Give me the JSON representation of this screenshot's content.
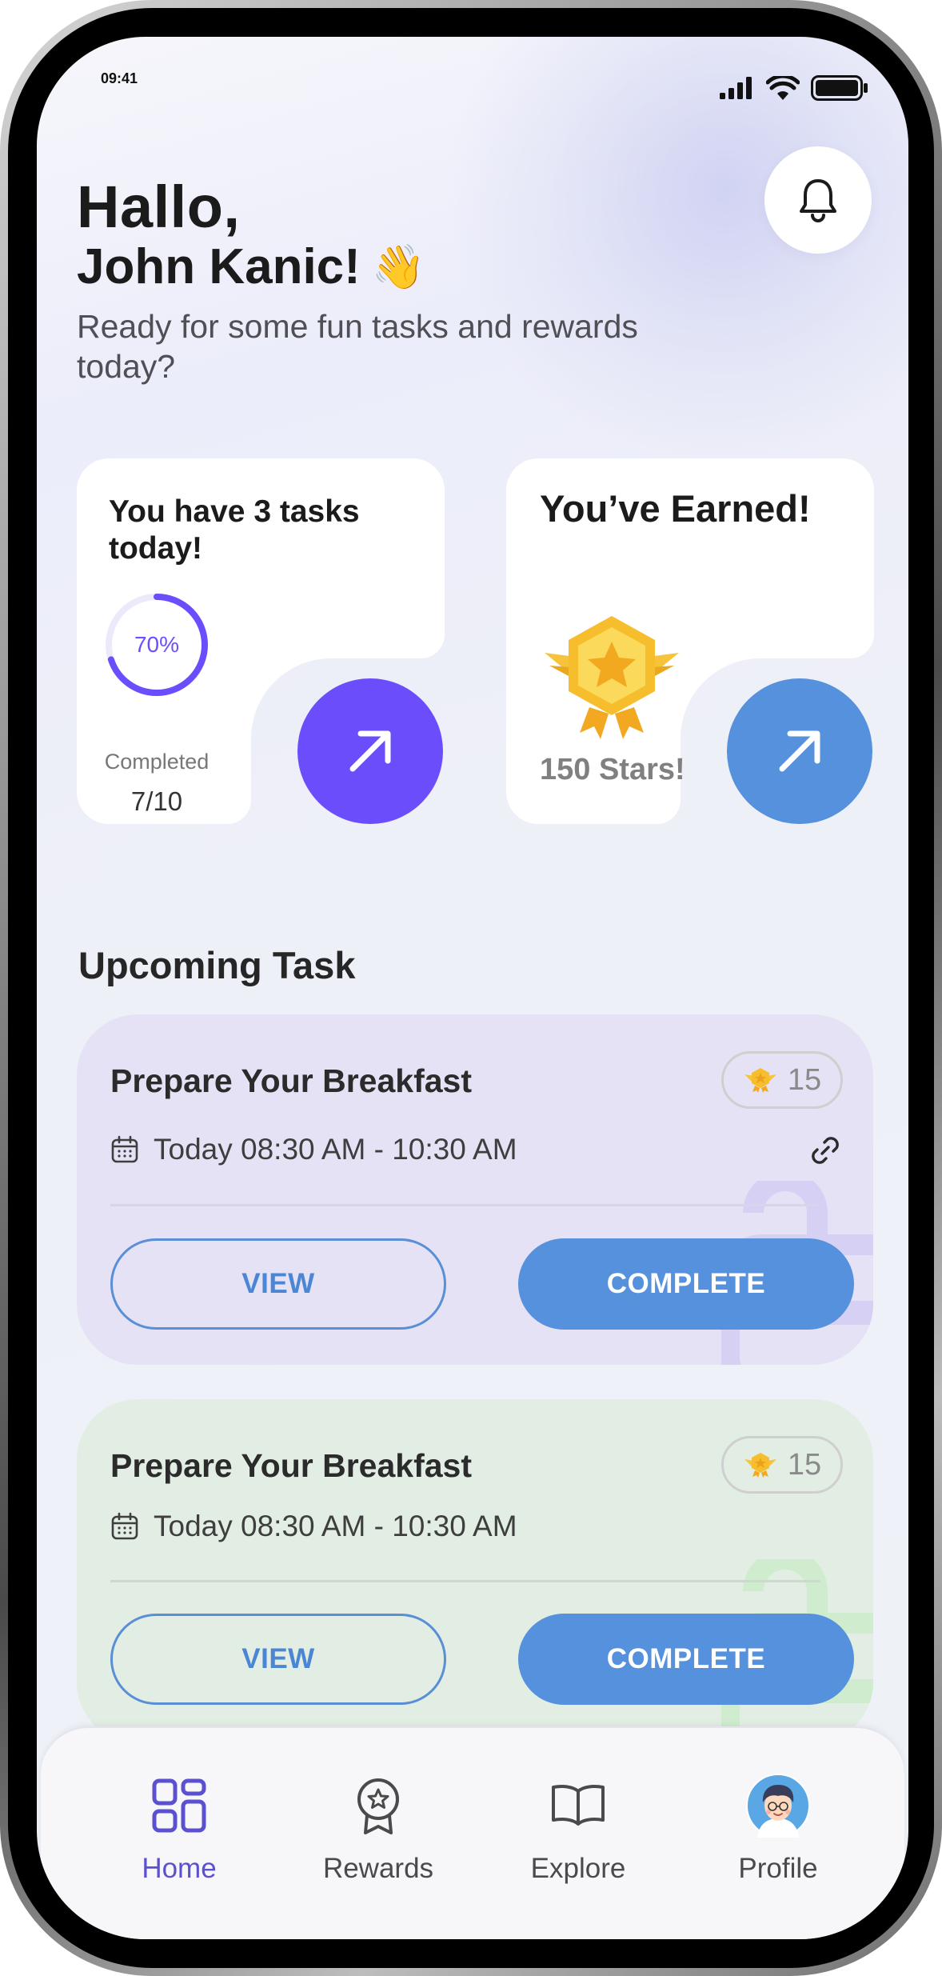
{
  "status_bar": {
    "time": "09:41"
  },
  "header": {
    "greeting": "Hallo,",
    "name": "John Kanic!",
    "wave_emoji": "👋",
    "subtitle": "Ready for some fun tasks and rewards today?"
  },
  "tasks_card": {
    "title": "You have 3 tasks today!",
    "progress_percent": 70,
    "progress_label": "70%",
    "completed_label": "Completed",
    "completed_value": "7/10"
  },
  "earned_card": {
    "title": "You’ve Earned!",
    "stars_text": "150 Stars!"
  },
  "upcoming": {
    "section_title": "Upcoming Task",
    "tasks": [
      {
        "name": "Prepare Your Breakfast",
        "points": "15",
        "time": "Today 08:30 AM - 10:30 AM",
        "view_label": "VIEW",
        "complete_label": "COMPLETE"
      },
      {
        "name": "Prepare Your Breakfast",
        "points": "15",
        "time": "Today 08:30 AM - 10:30 AM",
        "view_label": "VIEW",
        "complete_label": "COMPLETE"
      }
    ]
  },
  "bottom_nav": {
    "items": [
      {
        "label": "Home",
        "icon": "grid-icon",
        "active": true
      },
      {
        "label": "Rewards",
        "icon": "award-icon",
        "active": false
      },
      {
        "label": "Explore",
        "icon": "book-icon",
        "active": false
      },
      {
        "label": "Profile",
        "icon": "avatar",
        "active": false
      }
    ]
  },
  "colors": {
    "accent_purple": "#6b4dfc",
    "accent_blue": "#5591dc",
    "task_purple_bg": "#e6e2f6",
    "task_green_bg": "#e2eee4",
    "nav_active": "#5b51d0"
  }
}
